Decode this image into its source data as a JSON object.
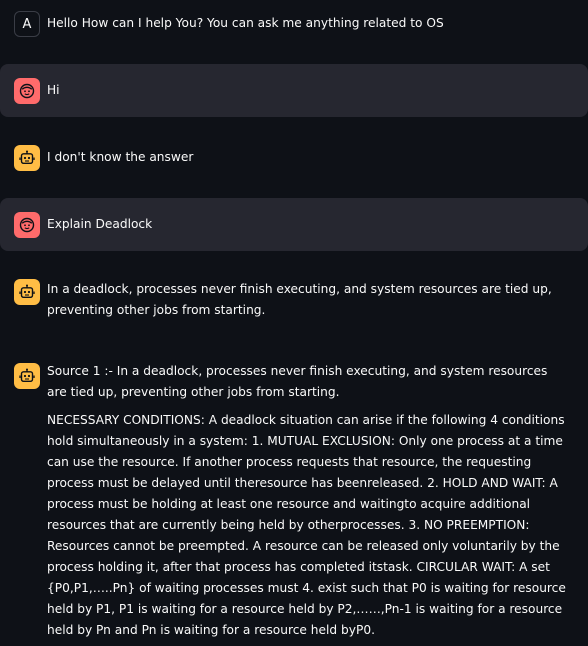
{
  "messages": [
    {
      "role": "assistant",
      "avatar": "initial-avatar",
      "initial": "A",
      "text": "Hello How can I help You? You can ask me anything related to OS"
    },
    {
      "role": "user",
      "avatar": "user-face-icon",
      "text": "Hi"
    },
    {
      "role": "assistant",
      "avatar": "bot-face-icon",
      "text": "I don't know the answer"
    },
    {
      "role": "user",
      "avatar": "user-face-icon",
      "text": "Explain Deadlock"
    },
    {
      "role": "assistant",
      "avatar": "bot-face-icon",
      "text": "In a deadlock, processes never finish executing, and system resources are tied up, preventing other jobs from starting."
    },
    {
      "role": "assistant",
      "avatar": "bot-face-icon",
      "paragraphs": [
        "Source 1 :- In a deadlock, processes never finish executing, and system resources are tied up, preventing other jobs from starting.",
        "NECESSARY CONDITIONS: A deadlock situation can arise if the following 4 conditions hold simultaneously in a system: 1. MUTUAL EXCLUSION: Only one process at a time can use the resource. If another process requests that resource, the requesting process must be delayed until theresource has beenreleased. 2. HOLD AND WAIT: A process must be holding at least one resource and waitingto acquire additional resources that are currently being held by otherprocesses. 3. NO PREEMPTION: Resources cannot be preempted. A resource can be released only voluntarily by the process holding it, after that process has completed itstask. CIRCULAR WAIT: A set {P0,P1,…..Pn} of waiting processes must 4. exist such that P0 is waiting for resource held by P1, P1 is waiting for a resource held by P2,……,Pn-1 is waiting for a resource held by Pn and Pn is waiting for a resource held byP0."
      ]
    }
  ],
  "colors": {
    "background": "#0e1117",
    "user_row": "#262730",
    "user_avatar": "#ff6b6b",
    "bot_avatar": "#ffbd45",
    "text": "#fafafa"
  }
}
